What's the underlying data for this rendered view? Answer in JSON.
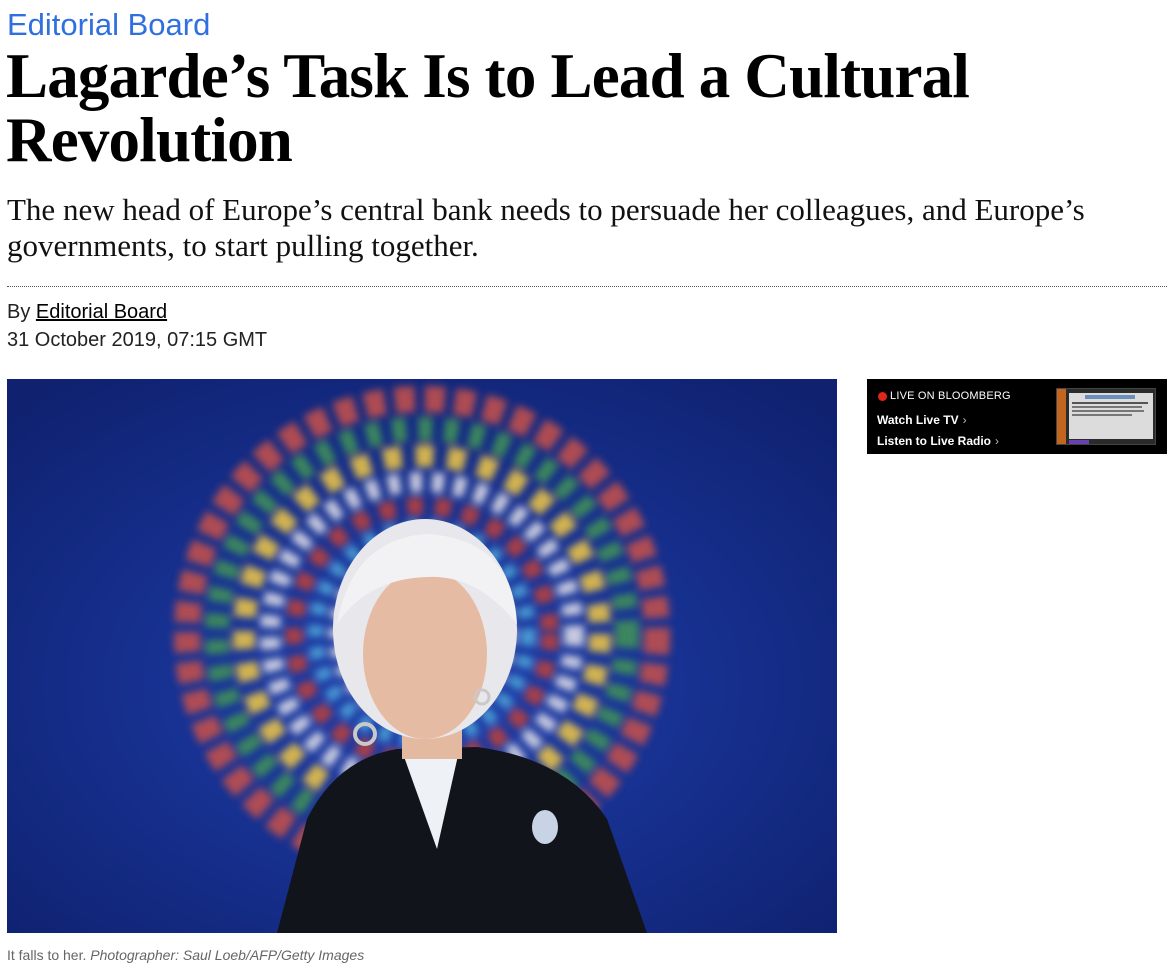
{
  "article": {
    "kicker": "Editorial Board",
    "headline": "Lagarde’s Task Is to Lead a Cultural Revolution",
    "dek": "The new head of Europe’s central bank needs to persuade her colleagues, and Europe’s governments, to start pulling together.",
    "byline_prefix": "By",
    "author": "Editorial Board",
    "date": "31 October 2019, 07:15 GMT"
  },
  "photo": {
    "caption": "It falls to her.",
    "credit": "Photographer: Saul Loeb/AFP/Getty Images"
  },
  "live": {
    "label": "LIVE ON BLOOMBERG",
    "watch": "Watch Live TV",
    "listen": "Listen to Live Radio"
  },
  "colors": {
    "kicker": "#2f6fe0",
    "live_dot": "#e0261b"
  }
}
